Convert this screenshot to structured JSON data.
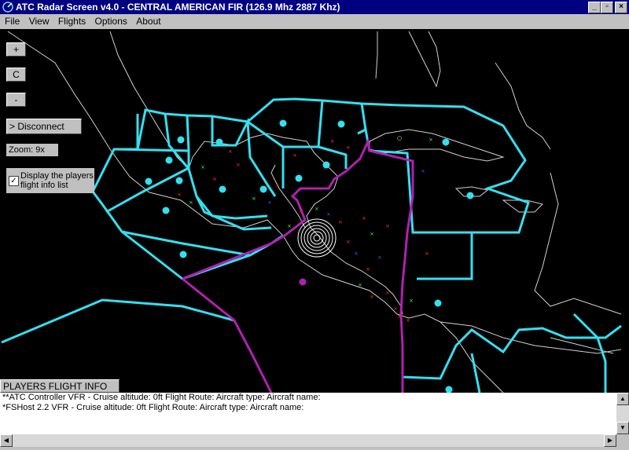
{
  "window": {
    "title": "ATC Radar Screen v4.0 - CENTRAL AMERICAN FIR (126.9 Mhz  2887 Khz)",
    "minimize": "_",
    "maximize": "▫",
    "close": "×"
  },
  "menu": [
    "File",
    "View",
    "Flights",
    "Options",
    "About"
  ],
  "controls": {
    "zoom_in": "+",
    "center": "C",
    "zoom_out": "-",
    "disconnect": "> Disconnect",
    "zoom_label": "Zoom:   9x",
    "display_players_label": "Display the players flight info list",
    "display_players_checked": "✓"
  },
  "info_list": {
    "label": "PLAYERS FLIGHT INFO LIST:",
    "rows": [
      "**ATC Controller   VFR   -   Cruise altitude: 0ft   Flight Route:    Aircraft type:    Aircraft name:",
      "*FSHost 2.2   VFR   -   Cruise altitude: 0ft   Flight Route:    Aircraft type:    Aircraft name:"
    ]
  },
  "colors": {
    "fir_boundary": "#33e0f0",
    "route": "#b020b0",
    "coast": "#d0d0d0",
    "background": "#000000"
  },
  "icons": {
    "app": "radar-app-icon",
    "scroll_up": "arrow-up-icon",
    "scroll_down": "arrow-down-icon",
    "scroll_left": "arrow-left-icon",
    "scroll_right": "arrow-right-icon"
  }
}
